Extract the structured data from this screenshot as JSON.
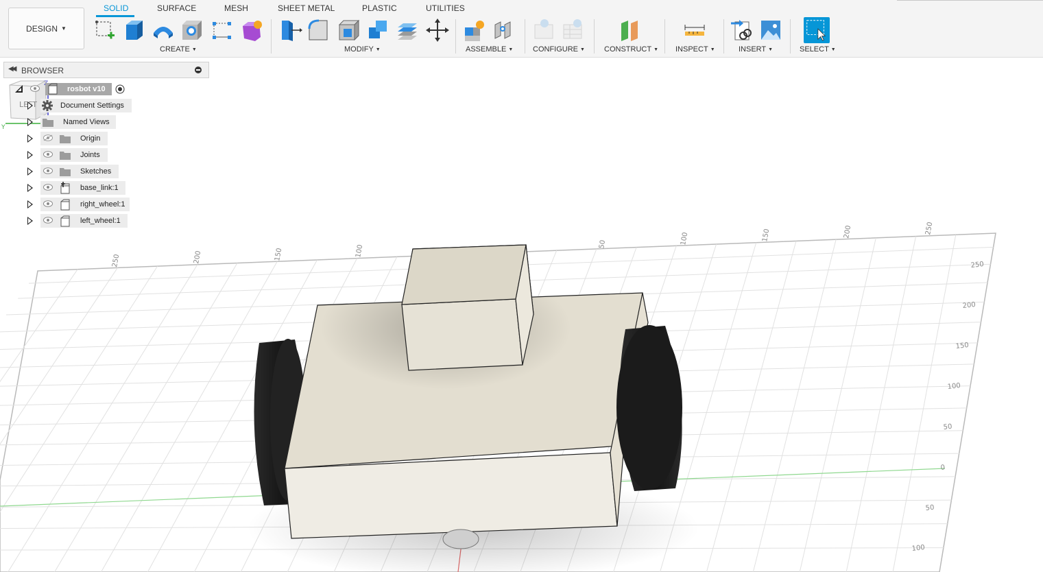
{
  "workspace": {
    "label": "DESIGN"
  },
  "tabs": [
    {
      "label": "SOLID",
      "active": true
    },
    {
      "label": "SURFACE",
      "active": false
    },
    {
      "label": "MESH",
      "active": false
    },
    {
      "label": "SHEET METAL",
      "active": false
    },
    {
      "label": "PLASTIC",
      "active": false
    },
    {
      "label": "UTILITIES",
      "active": false
    }
  ],
  "groups": {
    "create": "CREATE",
    "modify": "MODIFY",
    "assemble": "ASSEMBLE",
    "configure": "CONFIGURE",
    "construct": "CONSTRUCT",
    "inspect": "INSPECT",
    "insert": "INSERT",
    "select": "SELECT"
  },
  "browser": {
    "title": "BROWSER",
    "root": "rosbot v10",
    "items": [
      {
        "label": "Document Settings",
        "icon": "gear-icon"
      },
      {
        "label": "Named Views",
        "icon": "folder-icon"
      },
      {
        "label": "Origin",
        "icon": "folder-icon",
        "visibility": "hidden"
      },
      {
        "label": "Joints",
        "icon": "folder-icon",
        "visibility": "visible"
      },
      {
        "label": "Sketches",
        "icon": "folder-icon",
        "visibility": "visible"
      },
      {
        "label": "base_link:1",
        "icon": "component-anchor-icon",
        "visibility": "visible"
      },
      {
        "label": "right_wheel:1",
        "icon": "component-icon",
        "visibility": "visible"
      },
      {
        "label": "left_wheel:1",
        "icon": "component-icon",
        "visibility": "visible"
      }
    ]
  },
  "viewcube": {
    "face": "LEFT",
    "axes": {
      "x": "X",
      "y": "Y",
      "z": "Z"
    }
  },
  "grid": {
    "top_ticks": [
      "250",
      "200",
      "150",
      "100",
      "50",
      "100",
      "150",
      "200",
      "250"
    ],
    "right_ticks": [
      "250",
      "200",
      "150",
      "100",
      "50",
      "0",
      "50",
      "100"
    ]
  },
  "colors": {
    "accent": "#0696d7",
    "body": "#dcd8cc",
    "wheel": "#1c1c1c",
    "grid": "#d8d8d8",
    "axis_green": "#7ed07e",
    "axis_red": "#e05050"
  }
}
